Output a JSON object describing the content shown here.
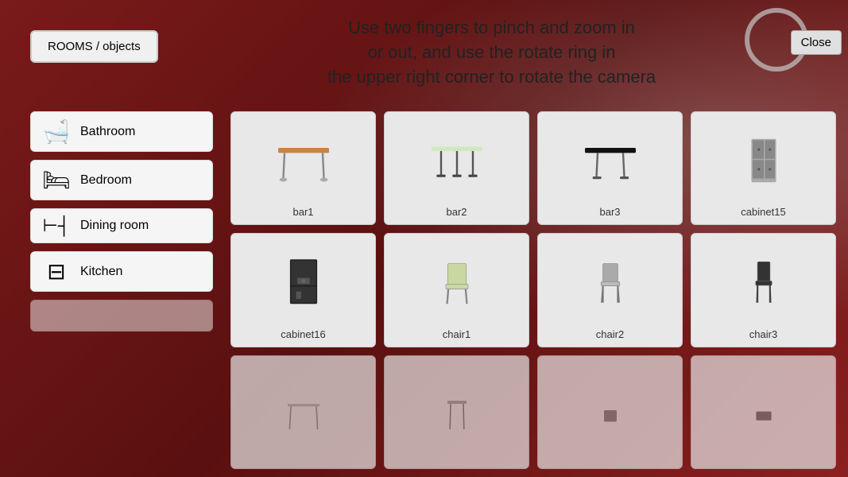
{
  "header": {
    "instruction": "Use two fingers to pinch and zoom in\nor out, and use the rotate ring in\nthe upper right corner to rotate the camera",
    "rooms_label": "ROOMS / objects",
    "close_label": "Close"
  },
  "sidebar": {
    "items": [
      {
        "id": "bathroom",
        "label": "Bathroom",
        "icon": "🛁"
      },
      {
        "id": "bedroom",
        "label": "Bedroom",
        "icon": "🛏"
      },
      {
        "id": "dining-room",
        "label": "Dining room",
        "icon": "🪑"
      },
      {
        "id": "kitchen",
        "label": "Kitchen",
        "icon": "🍳"
      },
      {
        "id": "more",
        "label": "...",
        "icon": ""
      }
    ]
  },
  "objects": [
    {
      "id": "bar1",
      "label": "bar1"
    },
    {
      "id": "bar2",
      "label": "bar2"
    },
    {
      "id": "bar3",
      "label": "bar3"
    },
    {
      "id": "cabinet15",
      "label": "cabinet15"
    },
    {
      "id": "cabinet16",
      "label": "cabinet16"
    },
    {
      "id": "chair1",
      "label": "chair1"
    },
    {
      "id": "chair2",
      "label": "chair2"
    },
    {
      "id": "chair3",
      "label": "chair3"
    },
    {
      "id": "item9",
      "label": ""
    },
    {
      "id": "item10",
      "label": ""
    },
    {
      "id": "item11",
      "label": ""
    },
    {
      "id": "item12",
      "label": ""
    }
  ]
}
